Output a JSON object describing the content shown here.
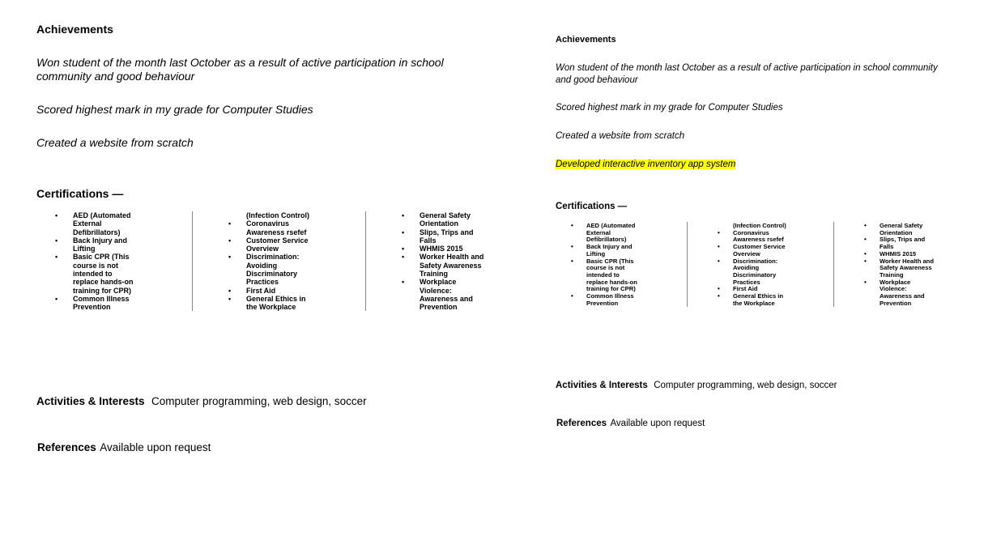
{
  "left_page": {
    "achievements_heading": "Achievements",
    "achievements": [
      "Won student of the month last October as a result of active participation in school community and good behaviour",
      "Scored highest mark in my grade for Computer Studies",
      "Created a website from scratch"
    ],
    "certifications_heading": "Certifications —",
    "cert_columns": [
      [
        {
          "text": "AED (Automated",
          "bullet": true
        },
        {
          "text": "External",
          "bullet": false
        },
        {
          "text": "Defibrillators)",
          "bullet": false
        },
        {
          "text": "Back Injury and",
          "bullet": true
        },
        {
          "text": "Lifting",
          "bullet": false
        },
        {
          "text": "Basic CPR (This",
          "bullet": true
        },
        {
          "text": "course is not",
          "bullet": false
        },
        {
          "text": "intended to",
          "bullet": false
        },
        {
          "text": "replace hands-on",
          "bullet": false
        },
        {
          "text": "training for CPR)",
          "bullet": false
        },
        {
          "text": "Common Illness",
          "bullet": true
        },
        {
          "text": "Prevention",
          "bullet": false
        }
      ],
      [
        {
          "text": "(Infection Control)",
          "bullet": false
        },
        {
          "text": "Coronavirus",
          "bullet": true
        },
        {
          "text": "Awareness rsefef",
          "bullet": false
        },
        {
          "text": "Customer Service",
          "bullet": true
        },
        {
          "text": "Overview",
          "bullet": false
        },
        {
          "text": "Discrimination:",
          "bullet": true
        },
        {
          "text": "Avoiding",
          "bullet": false
        },
        {
          "text": "Discriminatory",
          "bullet": false
        },
        {
          "text": "Practices",
          "bullet": false
        },
        {
          "text": "First Aid",
          "bullet": true
        },
        {
          "text": "General Ethics in",
          "bullet": true
        },
        {
          "text": "the Workplace",
          "bullet": false
        }
      ],
      [
        {
          "text": "General Safety",
          "bullet": true
        },
        {
          "text": "Orientation",
          "bullet": false
        },
        {
          "text": "Slips, Trips and",
          "bullet": true
        },
        {
          "text": "Falls",
          "bullet": false
        },
        {
          "text": "WHMIS 2015",
          "bullet": true
        },
        {
          "text": "Worker Health and",
          "bullet": true
        },
        {
          "text": "Safety Awareness",
          "bullet": false
        },
        {
          "text": "Training",
          "bullet": false
        },
        {
          "text": "Workplace",
          "bullet": true
        },
        {
          "text": "Violence:",
          "bullet": false
        },
        {
          "text": "Awareness and",
          "bullet": false
        },
        {
          "text": "Prevention",
          "bullet": false
        }
      ]
    ],
    "activities_label": "Activities & Interests",
    "activities_text": "Computer programming, web design, soccer",
    "references_label": "References",
    "references_text": "Available upon request"
  },
  "right_page": {
    "achievements_heading": "Achievements",
    "achievements": [
      "Won student of the month last October as a result of active participation in school community and good behaviour",
      "Scored highest mark in my grade for Computer Studies",
      "Created a website from scratch"
    ],
    "highlighted_achievement": "Developed interactive inventory app system",
    "highlight_color": "#ffff00",
    "certifications_heading": "Certifications —",
    "cert_columns": [
      [
        {
          "text": "AED (Automated",
          "bullet": true
        },
        {
          "text": "External",
          "bullet": false
        },
        {
          "text": "Defibrillators)",
          "bullet": false
        },
        {
          "text": "Back Injury and",
          "bullet": true
        },
        {
          "text": "Lifting",
          "bullet": false
        },
        {
          "text": "Basic CPR (This",
          "bullet": true
        },
        {
          "text": "course is not",
          "bullet": false
        },
        {
          "text": "intended to",
          "bullet": false
        },
        {
          "text": "replace hands-on",
          "bullet": false
        },
        {
          "text": "training for CPR)",
          "bullet": false
        },
        {
          "text": "Common Illness",
          "bullet": true
        },
        {
          "text": "Prevention",
          "bullet": false
        }
      ],
      [
        {
          "text": "(Infection Control)",
          "bullet": false
        },
        {
          "text": "Coronavirus",
          "bullet": true
        },
        {
          "text": "Awareness rsefef",
          "bullet": false
        },
        {
          "text": "Customer Service",
          "bullet": true
        },
        {
          "text": "Overview",
          "bullet": false
        },
        {
          "text": "Discrimination:",
          "bullet": true
        },
        {
          "text": "Avoiding",
          "bullet": false
        },
        {
          "text": "Discriminatory",
          "bullet": false
        },
        {
          "text": "Practices",
          "bullet": false
        },
        {
          "text": "First Aid",
          "bullet": true
        },
        {
          "text": "General Ethics in",
          "bullet": true
        },
        {
          "text": "the Workplace",
          "bullet": false
        }
      ],
      [
        {
          "text": "General Safety",
          "bullet": true
        },
        {
          "text": "Orientation",
          "bullet": false
        },
        {
          "text": "Slips, Trips and",
          "bullet": true
        },
        {
          "text": "Falls",
          "bullet": false
        },
        {
          "text": "WHMIS 2015",
          "bullet": true
        },
        {
          "text": "Worker Health and",
          "bullet": true
        },
        {
          "text": "Safety Awareness",
          "bullet": false
        },
        {
          "text": "Training",
          "bullet": false
        },
        {
          "text": "Workplace",
          "bullet": true
        },
        {
          "text": "Violence:",
          "bullet": false
        },
        {
          "text": "Awareness and",
          "bullet": false
        },
        {
          "text": "Prevention",
          "bullet": false
        }
      ]
    ],
    "activities_label": "Activities & Interests",
    "activities_text": "Computer programming, web design, soccer",
    "references_label": "References",
    "references_text": "Available upon request"
  }
}
